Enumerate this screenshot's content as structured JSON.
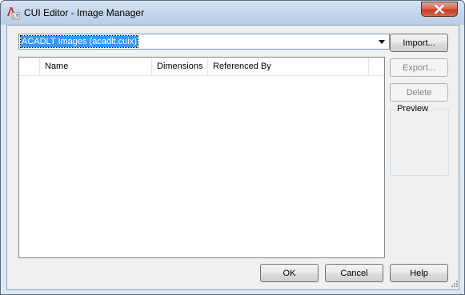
{
  "window": {
    "title": "CUI Editor - Image Manager",
    "app_icon": "autocad-lt-icon",
    "close_icon": "close-icon"
  },
  "source_combo": {
    "value": "ACADLT Images (acadlt.cuix)",
    "arrow_icon": "dropdown-arrow-icon"
  },
  "image_list": {
    "columns": [
      "Name",
      "Dimensions",
      "Referenced By"
    ],
    "rows": []
  },
  "side_buttons": {
    "import": "Import...",
    "export": "Export...",
    "delete": "Delete"
  },
  "preview": {
    "label": "Preview"
  },
  "footer_buttons": {
    "ok": "OK",
    "cancel": "Cancel",
    "help": "Help"
  },
  "colors": {
    "selection": "#3399ff",
    "close_button": "#c43d25",
    "dialog_bg": "#f0f0f0"
  }
}
